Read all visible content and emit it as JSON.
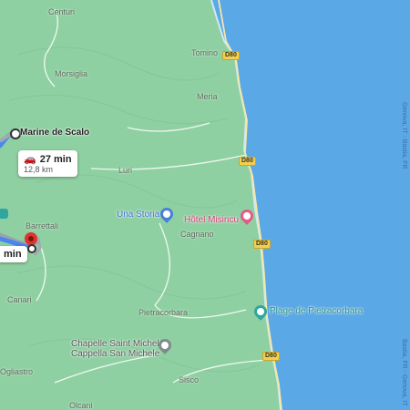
{
  "places": {
    "centuri": "Centuri",
    "tomino": "Tomino",
    "morsiglia": "Morsiglia",
    "meria": "Meria",
    "luri": "Luri",
    "barrettali": "Barrettali",
    "cagnano": "Cagnano",
    "canari": "Canari",
    "pietracorbara": "Pietracorbara",
    "ogliastro": "Ogliastro",
    "sisco": "Sisco",
    "olcani": "Olcani"
  },
  "origin": {
    "name": "Marine de Scalo"
  },
  "pois": {
    "una_storia": "Una Storia",
    "hotel": "Hôtel Misincu",
    "beach": "Plage de Pietracorbara",
    "chapel_line1": "Chapelle Saint Michel",
    "chapel_line2": "Cappella San Michele"
  },
  "roads": {
    "d80": "D80"
  },
  "route_cards": {
    "main": {
      "duration": "27 min",
      "distance": "12,8 km"
    },
    "alt": {
      "duration": "min"
    }
  },
  "sea": {
    "ferry_north": "Genova, IT - Bastia, FR",
    "ferry_south": "Bastia, FR - Genova, IT"
  },
  "colors": {
    "land": "#8fd0a2",
    "sea": "#5ba8e6",
    "route": "#4a86f0",
    "alt_route": "#9aa4ad",
    "pin": "#e0332c",
    "hotel_pin": "#e35b86",
    "poi_blue": "#4a7fd8",
    "beach_pin": "#2fa7a0"
  },
  "icons": {
    "car": "car-icon",
    "origin": "origin-dot-icon",
    "destination": "destination-pin-icon"
  }
}
